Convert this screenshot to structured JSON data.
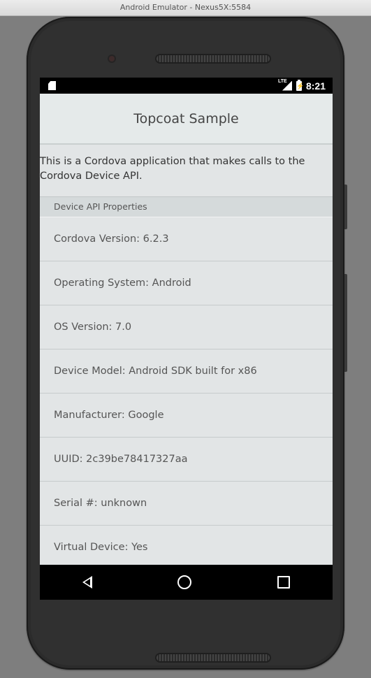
{
  "window": {
    "title": "Android Emulator - Nexus5X:5584"
  },
  "statusbar": {
    "time": "8:21",
    "network": "LTE"
  },
  "app": {
    "title": "Topcoat Sample",
    "description": "This is a Cordova application that makes calls to the Cordova Device API.",
    "section_header": "Device API Properties",
    "properties": [
      {
        "label": "Cordova Version: 6.2.3"
      },
      {
        "label": "Operating System: Android"
      },
      {
        "label": "OS Version: 7.0"
      },
      {
        "label": "Device Model: Android SDK built for x86"
      },
      {
        "label": "Manufacturer: Google"
      },
      {
        "label": "UUID: 2c39be78417327aa"
      },
      {
        "label": "Serial #: unknown"
      },
      {
        "label": "Virtual Device: Yes"
      }
    ]
  },
  "navbar": {
    "icons": [
      "back-icon",
      "home-icon",
      "recents-icon"
    ]
  }
}
